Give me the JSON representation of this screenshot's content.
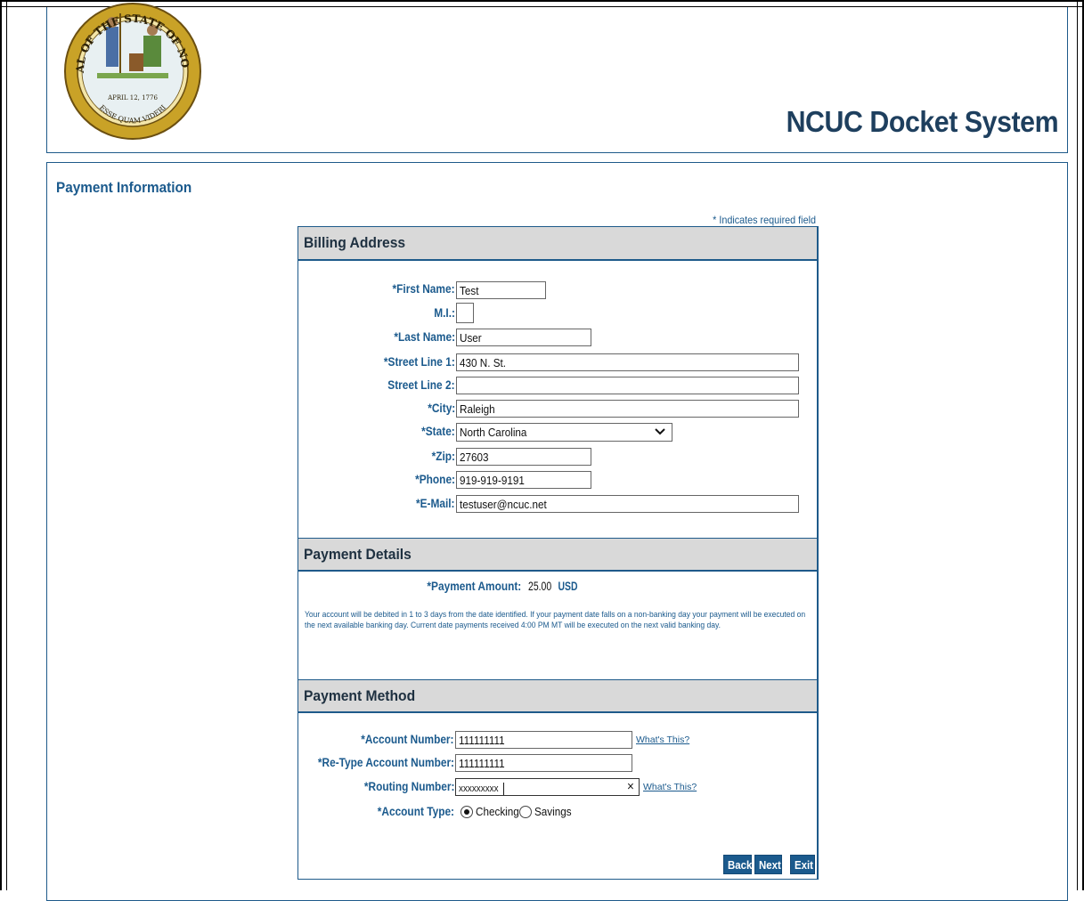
{
  "header": {
    "title": "NCUC Docket System",
    "seal": {
      "top_text": "THE GREAT SEAL OF THE STATE OF NORTH CAROLINA",
      "date": "APRIL 12, 1776",
      "motto": "ESSE QUAM VIDERI"
    }
  },
  "page": {
    "heading": "Payment Information",
    "required_note": "* Indicates required field"
  },
  "billing": {
    "title": "Billing Address",
    "fields": {
      "first_name": {
        "label": "*First Name:",
        "value": "Test"
      },
      "mi": {
        "label": "M.I.:",
        "value": ""
      },
      "last_name": {
        "label": "*Last Name:",
        "value": "User"
      },
      "street1": {
        "label": "*Street Line 1:",
        "value": "430 N. St."
      },
      "street2": {
        "label": "Street Line 2:",
        "value": ""
      },
      "city": {
        "label": "*City:",
        "value": "Raleigh"
      },
      "state": {
        "label": "*State:",
        "value": "North Carolina"
      },
      "zip": {
        "label": "*Zip:",
        "value": "27603"
      },
      "phone": {
        "label": "*Phone:",
        "value": "919-919-9191"
      },
      "email": {
        "label": "*E-Mail:",
        "value": "testuser@ncuc.net"
      }
    }
  },
  "details": {
    "title": "Payment Details",
    "amount_label": "*Payment Amount:",
    "amount_value": "25.00",
    "amount_currency": "USD",
    "notice": "Your account will be debited in 1 to 3 days from the date identified. If your payment date falls on a non-banking day your payment will be executed on the next available banking day. Current date payments received 4:00 PM MT will be executed on the next valid banking day."
  },
  "method": {
    "title": "Payment Method",
    "account_number": {
      "label": "*Account Number:",
      "value": "111111111"
    },
    "retype_account": {
      "label": "*Re-Type Account Number:",
      "value": "111111111"
    },
    "routing_number": {
      "label": "*Routing Number:",
      "value": "xxxxxxxxx"
    },
    "whats_this": "What's This?",
    "clear_icon": "×",
    "account_type": {
      "label": "*Account Type:",
      "options": [
        "Checking",
        "Savings"
      ],
      "selected": "Checking"
    }
  },
  "buttons": {
    "back": "Back",
    "next": "Next",
    "exit": "Exit"
  },
  "icons": {
    "chevron": "chevron-down-icon",
    "seal": "nc-state-seal-icon"
  },
  "colors": {
    "accent": "#1b5a8d",
    "section_bg": "#d9d9d9",
    "seal_gold": "#c9a227"
  }
}
